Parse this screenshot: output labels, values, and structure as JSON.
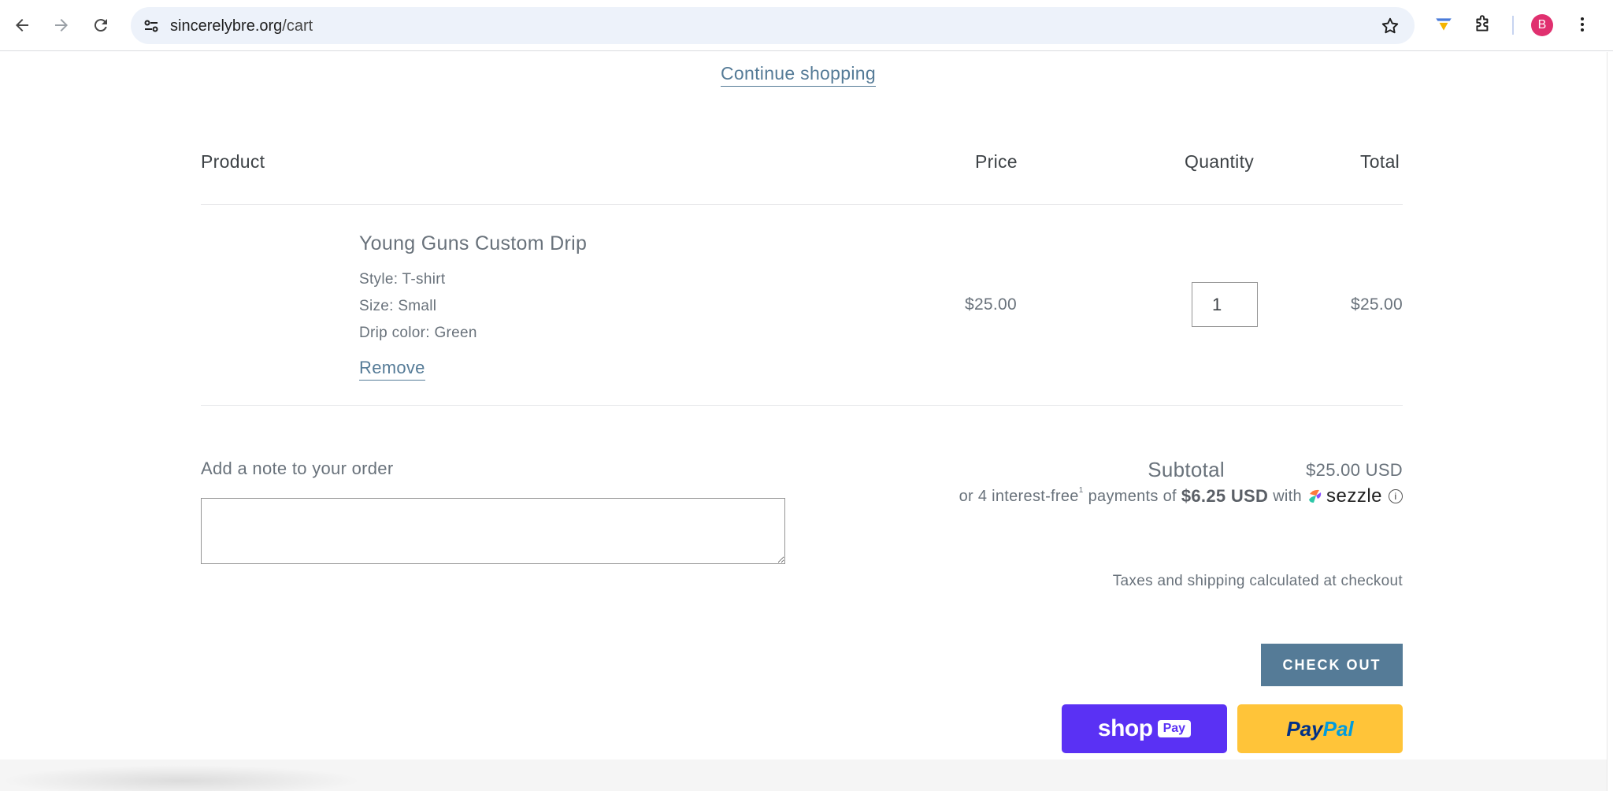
{
  "browser": {
    "url_host": "sincerelybre.org",
    "url_path": "/cart",
    "avatar_letter": "B"
  },
  "cart": {
    "continue_shopping": "Continue shopping",
    "headers": {
      "product": "Product",
      "price": "Price",
      "quantity": "Quantity",
      "total": "Total"
    },
    "item": {
      "title": "Young Guns Custom Drip",
      "style": "Style: T-shirt",
      "size": "Size: Small",
      "drip_color": "Drip color: Green",
      "remove": "Remove",
      "price": "$25.00",
      "quantity": "1",
      "total": "$25.00"
    },
    "note_label": "Add a note to your order",
    "subtotal_label": "Subtotal",
    "subtotal_value": "$25.00 USD",
    "sezzle": {
      "prefix": "or 4 interest-free",
      "superscript": "1",
      "middle": "payments of",
      "amount": "$6.25 USD",
      "with": "with",
      "brand": "sezzle",
      "info": "i"
    },
    "taxes_note": "Taxes and shipping calculated at checkout",
    "checkout_label": "CHECK OUT",
    "shoppay_label": "shop",
    "shoppay_badge": "Pay",
    "paypal_part1": "Pay",
    "paypal_part2": "Pal"
  },
  "colors": {
    "link": "#557b97",
    "checkout_bg": "#557b97",
    "shoppay_bg": "#5a31f4",
    "paypal_bg": "#ffc439",
    "avatar_bg": "#e0306f"
  }
}
